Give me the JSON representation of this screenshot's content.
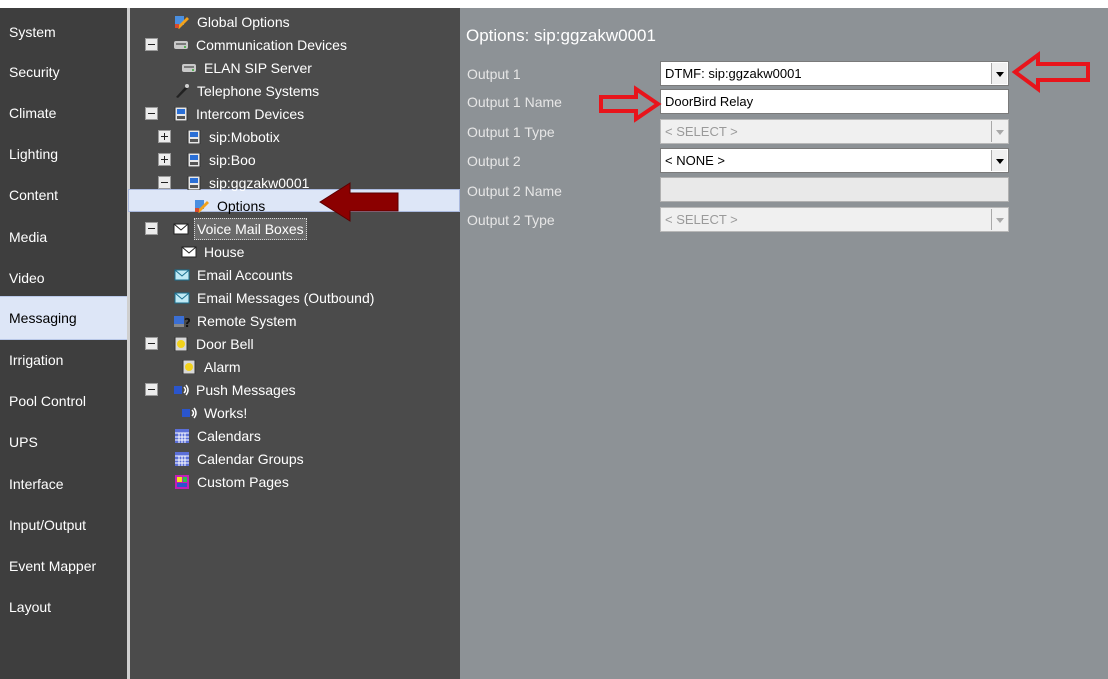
{
  "nav": {
    "items": [
      {
        "label": "System"
      },
      {
        "label": "Security"
      },
      {
        "label": "Climate"
      },
      {
        "label": "Lighting"
      },
      {
        "label": "Content"
      },
      {
        "label": "Media"
      },
      {
        "label": "Video"
      },
      {
        "label": "Messaging",
        "selected": true
      },
      {
        "label": "Irrigation"
      },
      {
        "label": "Pool Control"
      },
      {
        "label": "UPS"
      },
      {
        "label": "Interface"
      },
      {
        "label": "Input/Output"
      },
      {
        "label": "Event Mapper"
      },
      {
        "label": "Layout"
      }
    ]
  },
  "tree": {
    "global_options": "Global Options",
    "communication_devices": "Communication Devices",
    "elan_sip_server": "ELAN SIP Server",
    "telephone_systems": "Telephone Systems",
    "intercom_devices": "Intercom Devices",
    "sip_mobotix": "sip:Mobotix",
    "sip_boo": "sip:Boo",
    "sip_ggzakw0001": "sip:ggzakw0001",
    "options": "Options",
    "voice_mail_boxes": "Voice Mail Boxes",
    "house": "House",
    "email_accounts": "Email Accounts",
    "email_messages": "Email Messages (Outbound)",
    "remote_system": "Remote System",
    "door_bell": "Door Bell",
    "alarm": "Alarm",
    "push_messages": "Push Messages",
    "works": "Works!",
    "calendars": "Calendars",
    "calendar_groups": "Calendar Groups",
    "custom_pages": "Custom Pages"
  },
  "panel": {
    "title": "Options: sip:ggzakw0001",
    "output1_label": "Output 1",
    "output1_value": "DTMF: sip:ggzakw0001",
    "output1_name_label": "Output 1 Name",
    "output1_name_value": "DoorBird Relay",
    "output1_type_label": "Output 1 Type",
    "output1_type_value": "< SELECT >",
    "output2_label": "Output 2",
    "output2_value": "< NONE >",
    "output2_name_label": "Output 2 Name",
    "output2_name_value": "",
    "output2_type_label": "Output 2 Type",
    "output2_type_value": "< SELECT >"
  },
  "colors": {
    "nav_bg": "#3e3e3e",
    "tree_bg": "#4b4b4b",
    "panel_bg": "#8d9296",
    "selected_bg": "#dde6f7",
    "annotation_red": "#e8141b",
    "annotation_dark_red": "#8b0000"
  },
  "icons": {
    "options": "wrench-options-icon",
    "server": "server-icon",
    "phone": "telephone-icon",
    "intercom": "intercom-icon",
    "mail": "envelope-icon",
    "remote": "remote-system-icon",
    "bell": "door-bell-icon",
    "push": "push-message-icon",
    "calendar": "calendar-icon",
    "custom": "custom-pages-icon"
  }
}
